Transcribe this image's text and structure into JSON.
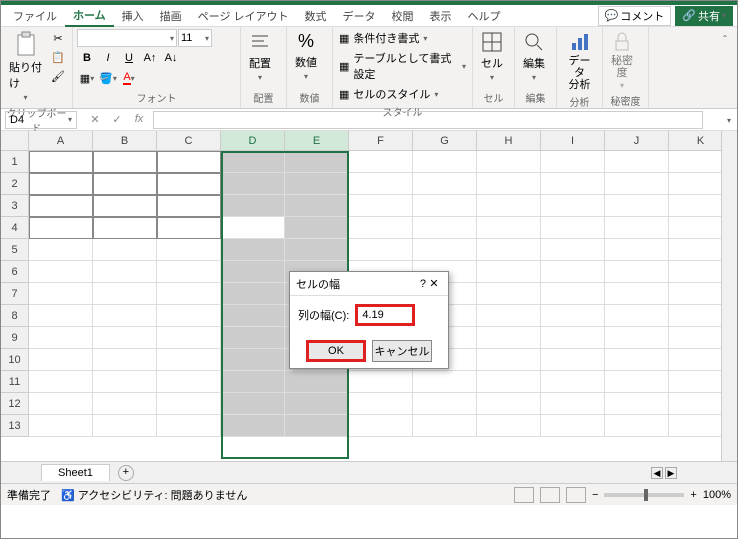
{
  "menu": {
    "file": "ファイル",
    "home": "ホーム",
    "insert": "挿入",
    "draw": "描画",
    "pagelayout": "ページ レイアウト",
    "formulas": "数式",
    "data": "データ",
    "review": "校閲",
    "view": "表示",
    "help": "ヘルプ",
    "comments": "コメント",
    "share": "共有"
  },
  "ribbon": {
    "clipboard": {
      "paste": "貼り付け",
      "label": "クリップボード"
    },
    "font": {
      "name": "",
      "size": "11",
      "label": "フォント",
      "bold": "B",
      "italic": "I",
      "underline": "U"
    },
    "align": {
      "big": "配置",
      "label": "配置"
    },
    "number": {
      "big": "数値",
      "pct": "%",
      "label": "数値"
    },
    "styles": {
      "cond": "条件付き書式",
      "table": "テーブルとして書式設定",
      "cell": "セルのスタイル",
      "label": "スタイル"
    },
    "cells": {
      "big": "セル",
      "label": "セル"
    },
    "editing": {
      "big": "編集",
      "label": "編集"
    },
    "analysis": {
      "data": "データ\n分析",
      "label": "分析"
    },
    "sensitivity": {
      "big": "秘密\n度",
      "label": "秘密度"
    }
  },
  "namebox": "D4",
  "columns": [
    "A",
    "B",
    "C",
    "D",
    "E",
    "F",
    "G",
    "H",
    "I",
    "J",
    "K"
  ],
  "dialog": {
    "title": "セルの幅",
    "help": "?",
    "close": "✕",
    "label": "列の幅(C):",
    "value": "4.19",
    "ok": "OK",
    "cancel": "キャンセル"
  },
  "sheet": {
    "tab": "Sheet1",
    "add": "+"
  },
  "status": {
    "ready": "準備完了",
    "access": "アクセシビリティ: 問題ありません",
    "zoom": "100%",
    "minus": "−",
    "plus": "+"
  }
}
